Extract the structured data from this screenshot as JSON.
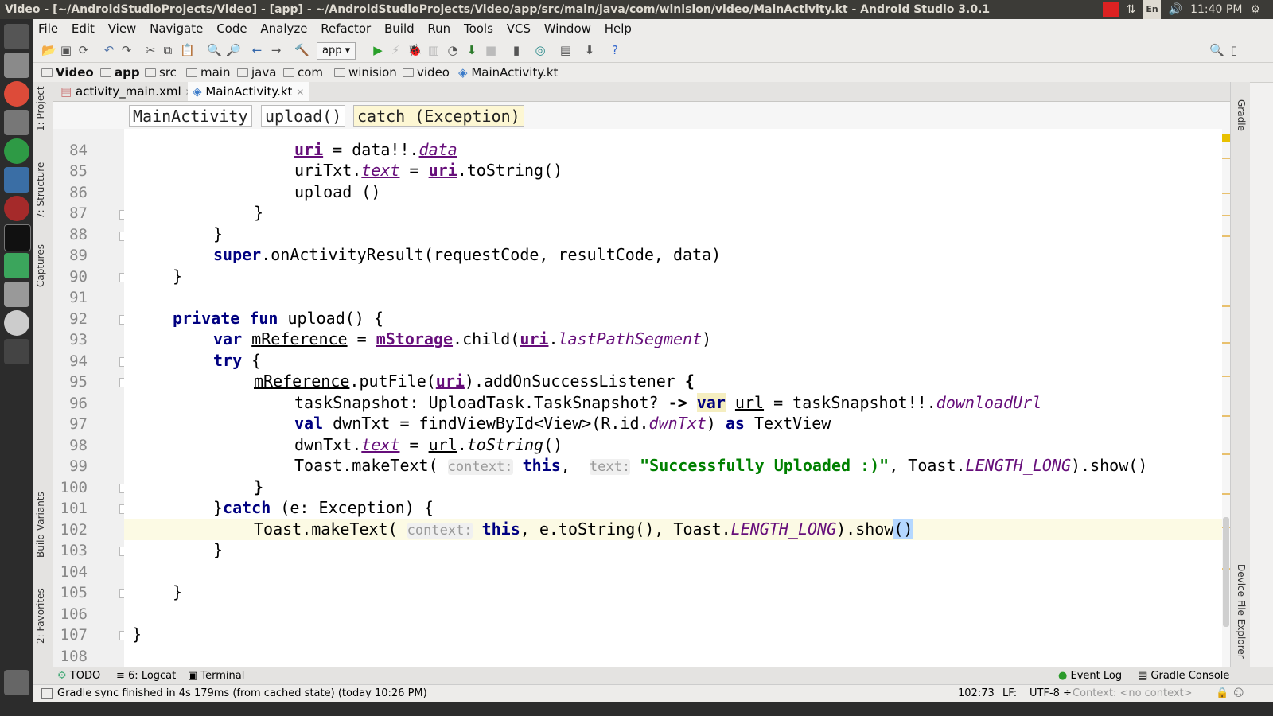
{
  "window": {
    "title": "Video - [~/AndroidStudioProjects/Video] - [app] - ~/AndroidStudioProjects/Video/app/src/main/java/com/winision/video/MainActivity.kt - Android Studio 3.0.1"
  },
  "tray": {
    "lang": "En",
    "time": "11:40 PM"
  },
  "menu": [
    "File",
    "Edit",
    "View",
    "Navigate",
    "Code",
    "Analyze",
    "Refactor",
    "Build",
    "Run",
    "Tools",
    "VCS",
    "Window",
    "Help"
  ],
  "toolbar": {
    "run_config": "app"
  },
  "breadcrumb": [
    "Video",
    "app",
    "src",
    "main",
    "java",
    "com",
    "winision",
    "video",
    "MainActivity.kt"
  ],
  "tabs": [
    "activity_main.xml",
    "MainActivity.kt"
  ],
  "left_tools": [
    "1: Project",
    "7: Structure",
    "Captures",
    "Build Variants",
    "2: Favorites"
  ],
  "right_tools": [
    "Gradle",
    "Device File Explorer"
  ],
  "structure": [
    "MainActivity",
    "upload()",
    "catch (Exception)"
  ],
  "lines": [
    {
      "n": "84"
    },
    {
      "n": "85"
    },
    {
      "n": "86"
    },
    {
      "n": "87"
    },
    {
      "n": "88"
    },
    {
      "n": "89"
    },
    {
      "n": "90"
    },
    {
      "n": "91"
    },
    {
      "n": "92"
    },
    {
      "n": "93"
    },
    {
      "n": "94"
    },
    {
      "n": "95"
    },
    {
      "n": "96"
    },
    {
      "n": "97"
    },
    {
      "n": "98"
    },
    {
      "n": "99"
    },
    {
      "n": "100"
    },
    {
      "n": "101"
    },
    {
      "n": "102"
    },
    {
      "n": "103"
    },
    {
      "n": "104"
    },
    {
      "n": "105"
    },
    {
      "n": "106"
    },
    {
      "n": "107"
    },
    {
      "n": "108"
    }
  ],
  "code": {
    "l84a": "uri",
    "l84b": " = data!!.",
    "l84c": "data",
    "l85a": "uriTxt.",
    "l85b": "text",
    "l85c": " = ",
    "l85d": "uri",
    "l85e": ".toString()",
    "l86": "upload ()",
    "l87": "}",
    "l88": "}",
    "l89a": "super",
    "l89b": ".onActivityResult(requestCode, resultCode, data)",
    "l90": "}",
    "l92a": "private fun",
    "l92b": " upload() {",
    "l93a": "var",
    "l93b": " ",
    "l93c": "mReference",
    "l93d": " = ",
    "l93e": "mStorage",
    "l93f": ".child(",
    "l93g": "uri",
    "l93h": ".",
    "l93i": "lastPathSegment",
    "l93j": ")",
    "l94a": "try",
    "l94b": " {",
    "l95a": "mReference",
    "l95b": ".putFile(",
    "l95c": "uri",
    "l95d": ").addOnSuccessListener ",
    "l95e": "{",
    "l96a": "taskSnapshot: UploadTask.TaskSnapshot? ",
    "l96b": "->",
    "l96c": " ",
    "l96d": "var",
    "l96e": " ",
    "l96f": "url",
    "l96g": " = taskSnapshot!!.",
    "l96h": "downloadUrl",
    "l97a": "val",
    "l97b": " dwnTxt = findViewById<View>(R.id.",
    "l97c": "dwnTxt",
    "l97d": ") ",
    "l97e": "as",
    "l97f": " TextView",
    "l98a": "dwnTxt.",
    "l98b": "text",
    "l98c": " = ",
    "l98d": "url",
    "l98e": ".",
    "l98f": "toString",
    "l98g": "()",
    "l99a": "Toast.makeText( ",
    "l99b": "context:",
    "l99c": " ",
    "l99d": "this",
    "l99e": ",  ",
    "l99f": "text:",
    "l99g": " ",
    "l99h": "\"Successfully Uploaded :)\"",
    "l99i": ", Toast.",
    "l99j": "LENGTH_LONG",
    "l99k": ").show()",
    "l100": "}",
    "l101a": "}",
    "l101b": "catch",
    "l101c": " (e: Exception) {",
    "l102a": "Toast.makeText( ",
    "l102b": "context:",
    "l102c": " ",
    "l102d": "this",
    "l102e": ", e.toString(), Toast.",
    "l102f": "LENGTH_LONG",
    "l102g": ").show",
    "l102h": "()",
    "l103": "}",
    "l105": "}",
    "l107": "}"
  },
  "tool_windows": {
    "todo": "TODO",
    "logcat": "6: Logcat",
    "terminal": "Terminal",
    "event_log": "Event Log",
    "gradle_console": "Gradle Console"
  },
  "status": {
    "message": "Gradle sync finished in 4s 179ms (from cached state) (today 10:26 PM)",
    "position": "102:73",
    "line_sep": "LF:",
    "encoding": "UTF-8",
    "context": "Context: <no context>"
  }
}
